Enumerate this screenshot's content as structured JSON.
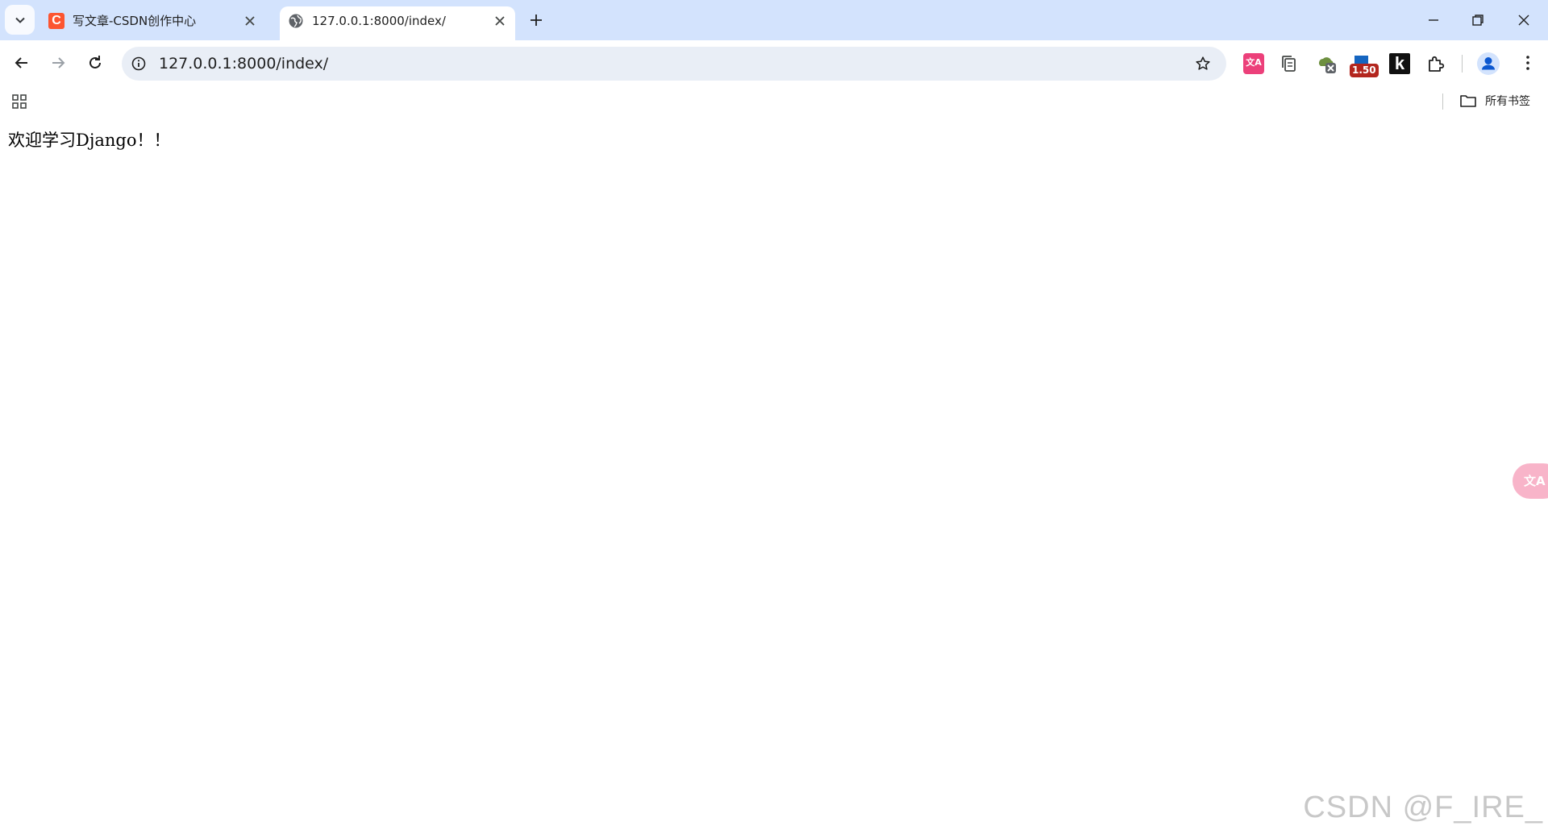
{
  "tabs": [
    {
      "title": "写文章-CSDN创作中心",
      "favicon": "C",
      "active": false
    },
    {
      "title": "127.0.0.1:8000/index/",
      "favicon": "globe-icon",
      "active": true
    }
  ],
  "toolbar": {
    "url": "127.0.0.1:8000/index/",
    "speed_badge": "1.50",
    "k_extension": "k",
    "translate_extension": "文A"
  },
  "bookmarks": {
    "all_bookmarks_label": "所有书签"
  },
  "page": {
    "text": "欢迎学习Django！！"
  },
  "overlay": {
    "translate_button": "文A",
    "watermark": "CSDN @F_IRE_"
  },
  "colors": {
    "tabstrip_bg": "#d3e3fd",
    "omnibox_bg": "#e9eef6",
    "csdn_brand": "#fc5531",
    "translate_ext": "#ec407a",
    "badge_red": "#b3261e"
  }
}
